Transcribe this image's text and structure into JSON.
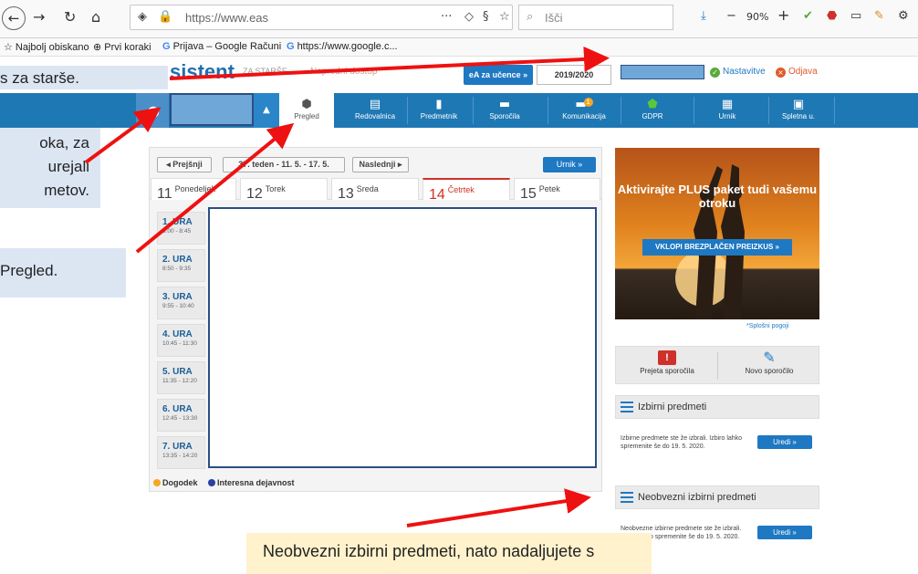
{
  "browser": {
    "url": "https://www.eas",
    "search_placeholder": "Išči",
    "zoom": "90%",
    "addon_badge": "1",
    "bookmarks": [
      "Najbolj obiskano",
      "Prvi koraki",
      "Prijava – Google Računi",
      "https://www.google.c..."
    ]
  },
  "site": {
    "brand": "sistent",
    "brand_sub": "ZA STARŠE",
    "header_dim_text": "Napredni dostop",
    "ea_button": "eA za učence »",
    "year": "2019/2020",
    "settings_link": "Nastavitve",
    "logout_link": "Odjava"
  },
  "nav": {
    "items": [
      {
        "label": "Pregled",
        "icon": "cube-icon"
      },
      {
        "label": "Redovalnica",
        "icon": "gradebook-icon"
      },
      {
        "label": "Predmetnik",
        "icon": "book-icon"
      },
      {
        "label": "Sporočila",
        "icon": "chat-icon"
      },
      {
        "label": "Komunikacija",
        "icon": "chat-bubbles-icon",
        "badge": "1"
      },
      {
        "label": "GDPR",
        "icon": "shield-check-icon"
      },
      {
        "label": "Urnik",
        "icon": "calendar-icon"
      },
      {
        "label": "Spletna u.",
        "icon": "classroom-icon"
      }
    ]
  },
  "timetable": {
    "prev": "◂ Prejšnji",
    "week": "37. teden - 11. 5. - 17. 5.",
    "next": "Naslednji ▸",
    "urnik": "Urnik »",
    "days": [
      {
        "num": "11",
        "name": "Ponedeljek"
      },
      {
        "num": "12",
        "name": "Torek"
      },
      {
        "num": "13",
        "name": "Sreda"
      },
      {
        "num": "14",
        "name": "Četrtek"
      },
      {
        "num": "15",
        "name": "Petek"
      }
    ],
    "hours": [
      {
        "label": "1. URA",
        "time": "8:00 - 8:45"
      },
      {
        "label": "2. URA",
        "time": "8:50 - 9:35"
      },
      {
        "label": "3. URA",
        "time": "9:55 - 10:40"
      },
      {
        "label": "4. URA",
        "time": "10:45 - 11:30"
      },
      {
        "label": "5. URA",
        "time": "11:35 - 12:20"
      },
      {
        "label": "6. URA",
        "time": "12:45 - 13:30"
      },
      {
        "label": "7. URA",
        "time": "13:35 - 14:20"
      }
    ],
    "legend": {
      "event": "Dogodek",
      "activity": "Interesna dejavnost"
    }
  },
  "right": {
    "ad_title": "Aktivirajte PLUS paket tudi vašemu otroku",
    "ad_button": "VKLOPI BREZPLAČEN PREIZKUS »",
    "terms": "*Splošni pogoji",
    "received": "Prejeta sporočila",
    "new_message": "Novo sporočilo",
    "elective": {
      "title": "Izbirni predmeti",
      "text": "Izbirne predmete ste že izbrali. Izbiro lahko spremenite še do 19. 5. 2020.",
      "button": "Uredi »"
    },
    "nonmandatory": {
      "title": "Neobvezni izbirni predmeti",
      "text": "Neobvezne izbirne predmete ste že izbrali. Izbiro lahko spremenite še do 19. 5. 2020.",
      "button": "Uredi »"
    }
  },
  "callouts": {
    "c1": "s za starše.",
    "c2_l1": "oka, za",
    "c2_l2": "urejali",
    "c2_l3": "metov.",
    "c3": "Pregled.",
    "c4": "Neobvezni izbirni predmeti, nato nadaljujete s"
  }
}
